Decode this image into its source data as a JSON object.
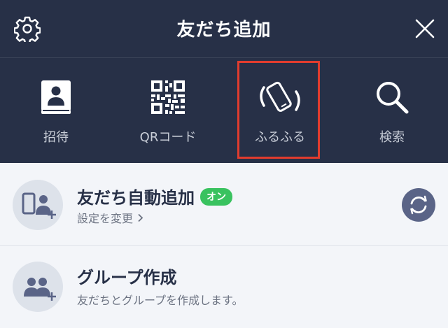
{
  "header": {
    "title": "友だち追加",
    "settings_icon": "gear-icon",
    "close_icon": "close-icon"
  },
  "tools": [
    {
      "label": "招待",
      "icon": "address-book-icon"
    },
    {
      "label": "QRコード",
      "icon": "qr-code-icon"
    },
    {
      "label": "ふるふる",
      "icon": "shake-phone-icon"
    },
    {
      "label": "検索",
      "icon": "search-icon"
    }
  ],
  "auto_add": {
    "title": "友だち自動追加",
    "badge": "オン",
    "subtitle": "設定を変更",
    "badge_color": "#39c25f"
  },
  "group": {
    "title": "グループ作成",
    "subtitle": "友だちとグループを作成します。"
  },
  "colors": {
    "header_bg": "#273047",
    "highlight": "#e23c2e",
    "list_bg": "#f3f5f9"
  }
}
